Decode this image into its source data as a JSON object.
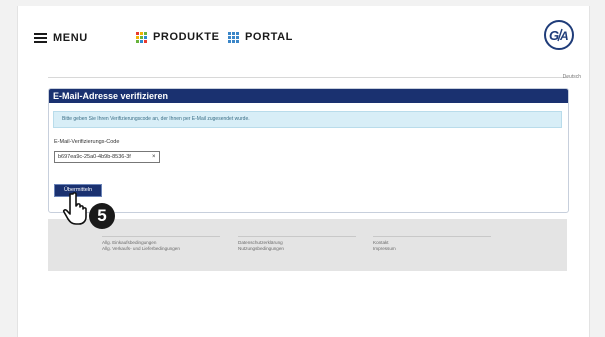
{
  "header": {
    "menu_label": "MENU",
    "produkte_label": "PRODUKTE",
    "portal_label": "PORTAL",
    "language": "Deutsch",
    "logo_alt": "GF",
    "colors": {
      "produkte_grid": [
        "#e83a2f",
        "#f0b400",
        "#68b33b",
        "#2a8ad0"
      ],
      "portal_grid": "#3b86c8",
      "brand": "#1f3c79"
    }
  },
  "verify": {
    "title": "E-Mail-Adresse verifizieren",
    "info_text": "Bitte geben Sie Ihren Verifizierungscode an, der Ihnen per E-Mail zugesendet wurde.",
    "code_label": "E-Mail-Verifizierungs-Code",
    "code_value": "b697ea9c-25a0-4b9b-8536-3f",
    "clear_icon": "×",
    "submit_label": "Übermitteln"
  },
  "footer": {
    "col1": [
      "Allg. Einkaufsbedingungen",
      "Allg. Verkaufs- und Lieferbedingungen"
    ],
    "col2": [
      "Datenschutzerklärung",
      "Nutzungsbedingungen"
    ],
    "col3": [
      "Kontakt",
      "Impressum"
    ]
  },
  "overlay": {
    "step_number": "5",
    "cursor_icon": "hand-pointer-icon"
  }
}
